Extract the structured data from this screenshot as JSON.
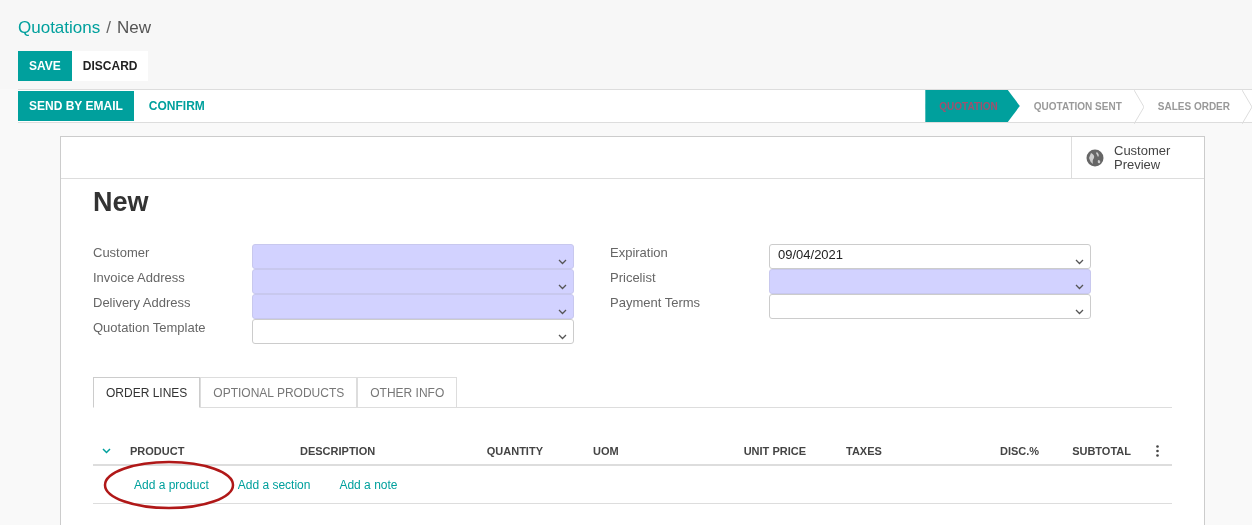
{
  "breadcrumb": [
    {
      "label": "Quotations",
      "kind": "link"
    },
    {
      "label": "/",
      "kind": "separator"
    },
    {
      "label": "New",
      "kind": "current"
    }
  ],
  "buttons": [
    {
      "label": "SAVE",
      "kind": "primary"
    },
    {
      "label": "DISCARD",
      "kind": "secondary"
    }
  ],
  "actions": [
    {
      "label": "SEND BY EMAIL",
      "kind": "primary"
    },
    {
      "label": "CONFIRM",
      "kind": "link"
    }
  ],
  "stages": [
    {
      "label": "QUOTATION",
      "selected": true
    },
    {
      "label": "QUOTATION SENT",
      "selected": false
    },
    {
      "label": "SALES ORDER",
      "selected": false
    }
  ],
  "preview_button": {
    "label": "Customer Preview"
  },
  "title": "New",
  "left_fields": [
    {
      "label": "Customer",
      "required": true
    },
    {
      "label": "Invoice Address",
      "required": true
    },
    {
      "label": "Delivery Address",
      "required": true
    },
    {
      "label": "Quotation Template",
      "required": false
    }
  ],
  "right_fields": [
    {
      "label": "Expiration",
      "required": false,
      "value": "09/04/2021"
    },
    {
      "label": "Pricelist",
      "required": true
    },
    {
      "label": "Payment Terms",
      "required": false
    }
  ],
  "tabs": [
    {
      "label": "ORDER LINES",
      "selected": true
    },
    {
      "label": "OPTIONAL PRODUCTS",
      "selected": false
    },
    {
      "label": "OTHER INFO",
      "selected": false
    }
  ],
  "columns": [
    "PRODUCT",
    "DESCRIPTION",
    "QUANTITY",
    "UOM",
    "UNIT PRICE",
    "TAXES",
    "DISC.%",
    "SUBTOTAL"
  ],
  "add_links": [
    {
      "label": "Add a product",
      "highlighted": true
    },
    {
      "label": "Add a section",
      "highlighted": false
    },
    {
      "label": "Add a note",
      "highlighted": false
    }
  ]
}
